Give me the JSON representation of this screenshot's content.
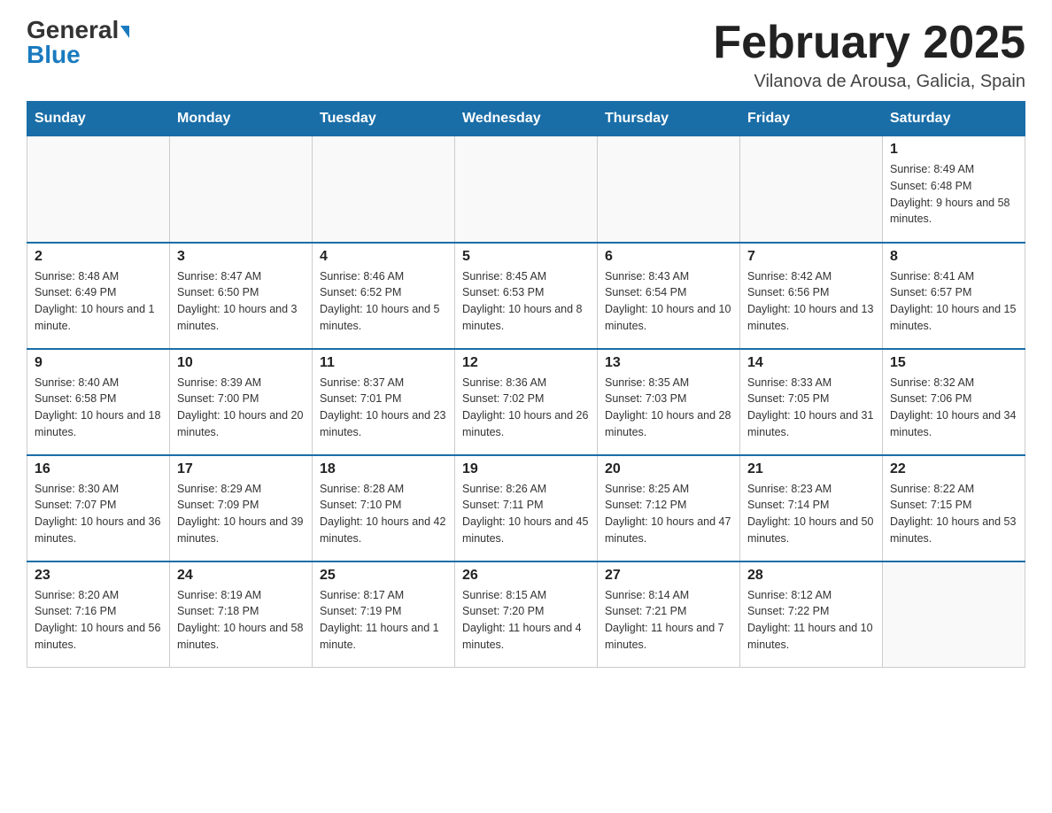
{
  "header": {
    "logo_line1": "General",
    "logo_line2": "Blue",
    "title": "February 2025",
    "subtitle": "Vilanova de Arousa, Galicia, Spain"
  },
  "weekdays": [
    "Sunday",
    "Monday",
    "Tuesday",
    "Wednesday",
    "Thursday",
    "Friday",
    "Saturday"
  ],
  "weeks": [
    [
      {
        "day": "",
        "info": ""
      },
      {
        "day": "",
        "info": ""
      },
      {
        "day": "",
        "info": ""
      },
      {
        "day": "",
        "info": ""
      },
      {
        "day": "",
        "info": ""
      },
      {
        "day": "",
        "info": ""
      },
      {
        "day": "1",
        "info": "Sunrise: 8:49 AM\nSunset: 6:48 PM\nDaylight: 9 hours and 58 minutes."
      }
    ],
    [
      {
        "day": "2",
        "info": "Sunrise: 8:48 AM\nSunset: 6:49 PM\nDaylight: 10 hours and 1 minute."
      },
      {
        "day": "3",
        "info": "Sunrise: 8:47 AM\nSunset: 6:50 PM\nDaylight: 10 hours and 3 minutes."
      },
      {
        "day": "4",
        "info": "Sunrise: 8:46 AM\nSunset: 6:52 PM\nDaylight: 10 hours and 5 minutes."
      },
      {
        "day": "5",
        "info": "Sunrise: 8:45 AM\nSunset: 6:53 PM\nDaylight: 10 hours and 8 minutes."
      },
      {
        "day": "6",
        "info": "Sunrise: 8:43 AM\nSunset: 6:54 PM\nDaylight: 10 hours and 10 minutes."
      },
      {
        "day": "7",
        "info": "Sunrise: 8:42 AM\nSunset: 6:56 PM\nDaylight: 10 hours and 13 minutes."
      },
      {
        "day": "8",
        "info": "Sunrise: 8:41 AM\nSunset: 6:57 PM\nDaylight: 10 hours and 15 minutes."
      }
    ],
    [
      {
        "day": "9",
        "info": "Sunrise: 8:40 AM\nSunset: 6:58 PM\nDaylight: 10 hours and 18 minutes."
      },
      {
        "day": "10",
        "info": "Sunrise: 8:39 AM\nSunset: 7:00 PM\nDaylight: 10 hours and 20 minutes."
      },
      {
        "day": "11",
        "info": "Sunrise: 8:37 AM\nSunset: 7:01 PM\nDaylight: 10 hours and 23 minutes."
      },
      {
        "day": "12",
        "info": "Sunrise: 8:36 AM\nSunset: 7:02 PM\nDaylight: 10 hours and 26 minutes."
      },
      {
        "day": "13",
        "info": "Sunrise: 8:35 AM\nSunset: 7:03 PM\nDaylight: 10 hours and 28 minutes."
      },
      {
        "day": "14",
        "info": "Sunrise: 8:33 AM\nSunset: 7:05 PM\nDaylight: 10 hours and 31 minutes."
      },
      {
        "day": "15",
        "info": "Sunrise: 8:32 AM\nSunset: 7:06 PM\nDaylight: 10 hours and 34 minutes."
      }
    ],
    [
      {
        "day": "16",
        "info": "Sunrise: 8:30 AM\nSunset: 7:07 PM\nDaylight: 10 hours and 36 minutes."
      },
      {
        "day": "17",
        "info": "Sunrise: 8:29 AM\nSunset: 7:09 PM\nDaylight: 10 hours and 39 minutes."
      },
      {
        "day": "18",
        "info": "Sunrise: 8:28 AM\nSunset: 7:10 PM\nDaylight: 10 hours and 42 minutes."
      },
      {
        "day": "19",
        "info": "Sunrise: 8:26 AM\nSunset: 7:11 PM\nDaylight: 10 hours and 45 minutes."
      },
      {
        "day": "20",
        "info": "Sunrise: 8:25 AM\nSunset: 7:12 PM\nDaylight: 10 hours and 47 minutes."
      },
      {
        "day": "21",
        "info": "Sunrise: 8:23 AM\nSunset: 7:14 PM\nDaylight: 10 hours and 50 minutes."
      },
      {
        "day": "22",
        "info": "Sunrise: 8:22 AM\nSunset: 7:15 PM\nDaylight: 10 hours and 53 minutes."
      }
    ],
    [
      {
        "day": "23",
        "info": "Sunrise: 8:20 AM\nSunset: 7:16 PM\nDaylight: 10 hours and 56 minutes."
      },
      {
        "day": "24",
        "info": "Sunrise: 8:19 AM\nSunset: 7:18 PM\nDaylight: 10 hours and 58 minutes."
      },
      {
        "day": "25",
        "info": "Sunrise: 8:17 AM\nSunset: 7:19 PM\nDaylight: 11 hours and 1 minute."
      },
      {
        "day": "26",
        "info": "Sunrise: 8:15 AM\nSunset: 7:20 PM\nDaylight: 11 hours and 4 minutes."
      },
      {
        "day": "27",
        "info": "Sunrise: 8:14 AM\nSunset: 7:21 PM\nDaylight: 11 hours and 7 minutes."
      },
      {
        "day": "28",
        "info": "Sunrise: 8:12 AM\nSunset: 7:22 PM\nDaylight: 11 hours and 10 minutes."
      },
      {
        "day": "",
        "info": ""
      }
    ]
  ]
}
